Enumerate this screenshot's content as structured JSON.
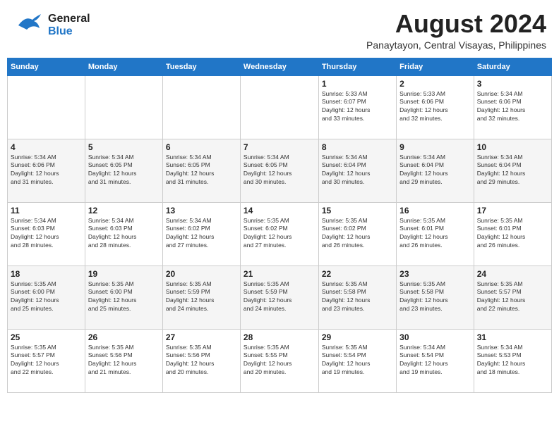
{
  "header": {
    "logo_general": "General",
    "logo_blue": "Blue",
    "month_year": "August 2024",
    "location": "Panaytayon, Central Visayas, Philippines"
  },
  "weekdays": [
    "Sunday",
    "Monday",
    "Tuesday",
    "Wednesday",
    "Thursday",
    "Friday",
    "Saturday"
  ],
  "weeks": [
    [
      {
        "day": "",
        "info": ""
      },
      {
        "day": "",
        "info": ""
      },
      {
        "day": "",
        "info": ""
      },
      {
        "day": "",
        "info": ""
      },
      {
        "day": "1",
        "info": "Sunrise: 5:33 AM\nSunset: 6:07 PM\nDaylight: 12 hours\nand 33 minutes."
      },
      {
        "day": "2",
        "info": "Sunrise: 5:33 AM\nSunset: 6:06 PM\nDaylight: 12 hours\nand 32 minutes."
      },
      {
        "day": "3",
        "info": "Sunrise: 5:34 AM\nSunset: 6:06 PM\nDaylight: 12 hours\nand 32 minutes."
      }
    ],
    [
      {
        "day": "4",
        "info": "Sunrise: 5:34 AM\nSunset: 6:06 PM\nDaylight: 12 hours\nand 31 minutes."
      },
      {
        "day": "5",
        "info": "Sunrise: 5:34 AM\nSunset: 6:05 PM\nDaylight: 12 hours\nand 31 minutes."
      },
      {
        "day": "6",
        "info": "Sunrise: 5:34 AM\nSunset: 6:05 PM\nDaylight: 12 hours\nand 31 minutes."
      },
      {
        "day": "7",
        "info": "Sunrise: 5:34 AM\nSunset: 6:05 PM\nDaylight: 12 hours\nand 30 minutes."
      },
      {
        "day": "8",
        "info": "Sunrise: 5:34 AM\nSunset: 6:04 PM\nDaylight: 12 hours\nand 30 minutes."
      },
      {
        "day": "9",
        "info": "Sunrise: 5:34 AM\nSunset: 6:04 PM\nDaylight: 12 hours\nand 29 minutes."
      },
      {
        "day": "10",
        "info": "Sunrise: 5:34 AM\nSunset: 6:04 PM\nDaylight: 12 hours\nand 29 minutes."
      }
    ],
    [
      {
        "day": "11",
        "info": "Sunrise: 5:34 AM\nSunset: 6:03 PM\nDaylight: 12 hours\nand 28 minutes."
      },
      {
        "day": "12",
        "info": "Sunrise: 5:34 AM\nSunset: 6:03 PM\nDaylight: 12 hours\nand 28 minutes."
      },
      {
        "day": "13",
        "info": "Sunrise: 5:34 AM\nSunset: 6:02 PM\nDaylight: 12 hours\nand 27 minutes."
      },
      {
        "day": "14",
        "info": "Sunrise: 5:35 AM\nSunset: 6:02 PM\nDaylight: 12 hours\nand 27 minutes."
      },
      {
        "day": "15",
        "info": "Sunrise: 5:35 AM\nSunset: 6:02 PM\nDaylight: 12 hours\nand 26 minutes."
      },
      {
        "day": "16",
        "info": "Sunrise: 5:35 AM\nSunset: 6:01 PM\nDaylight: 12 hours\nand 26 minutes."
      },
      {
        "day": "17",
        "info": "Sunrise: 5:35 AM\nSunset: 6:01 PM\nDaylight: 12 hours\nand 26 minutes."
      }
    ],
    [
      {
        "day": "18",
        "info": "Sunrise: 5:35 AM\nSunset: 6:00 PM\nDaylight: 12 hours\nand 25 minutes."
      },
      {
        "day": "19",
        "info": "Sunrise: 5:35 AM\nSunset: 6:00 PM\nDaylight: 12 hours\nand 25 minutes."
      },
      {
        "day": "20",
        "info": "Sunrise: 5:35 AM\nSunset: 5:59 PM\nDaylight: 12 hours\nand 24 minutes."
      },
      {
        "day": "21",
        "info": "Sunrise: 5:35 AM\nSunset: 5:59 PM\nDaylight: 12 hours\nand 24 minutes."
      },
      {
        "day": "22",
        "info": "Sunrise: 5:35 AM\nSunset: 5:58 PM\nDaylight: 12 hours\nand 23 minutes."
      },
      {
        "day": "23",
        "info": "Sunrise: 5:35 AM\nSunset: 5:58 PM\nDaylight: 12 hours\nand 23 minutes."
      },
      {
        "day": "24",
        "info": "Sunrise: 5:35 AM\nSunset: 5:57 PM\nDaylight: 12 hours\nand 22 minutes."
      }
    ],
    [
      {
        "day": "25",
        "info": "Sunrise: 5:35 AM\nSunset: 5:57 PM\nDaylight: 12 hours\nand 22 minutes."
      },
      {
        "day": "26",
        "info": "Sunrise: 5:35 AM\nSunset: 5:56 PM\nDaylight: 12 hours\nand 21 minutes."
      },
      {
        "day": "27",
        "info": "Sunrise: 5:35 AM\nSunset: 5:56 PM\nDaylight: 12 hours\nand 20 minutes."
      },
      {
        "day": "28",
        "info": "Sunrise: 5:35 AM\nSunset: 5:55 PM\nDaylight: 12 hours\nand 20 minutes."
      },
      {
        "day": "29",
        "info": "Sunrise: 5:35 AM\nSunset: 5:54 PM\nDaylight: 12 hours\nand 19 minutes."
      },
      {
        "day": "30",
        "info": "Sunrise: 5:34 AM\nSunset: 5:54 PM\nDaylight: 12 hours\nand 19 minutes."
      },
      {
        "day": "31",
        "info": "Sunrise: 5:34 AM\nSunset: 5:53 PM\nDaylight: 12 hours\nand 18 minutes."
      }
    ]
  ]
}
